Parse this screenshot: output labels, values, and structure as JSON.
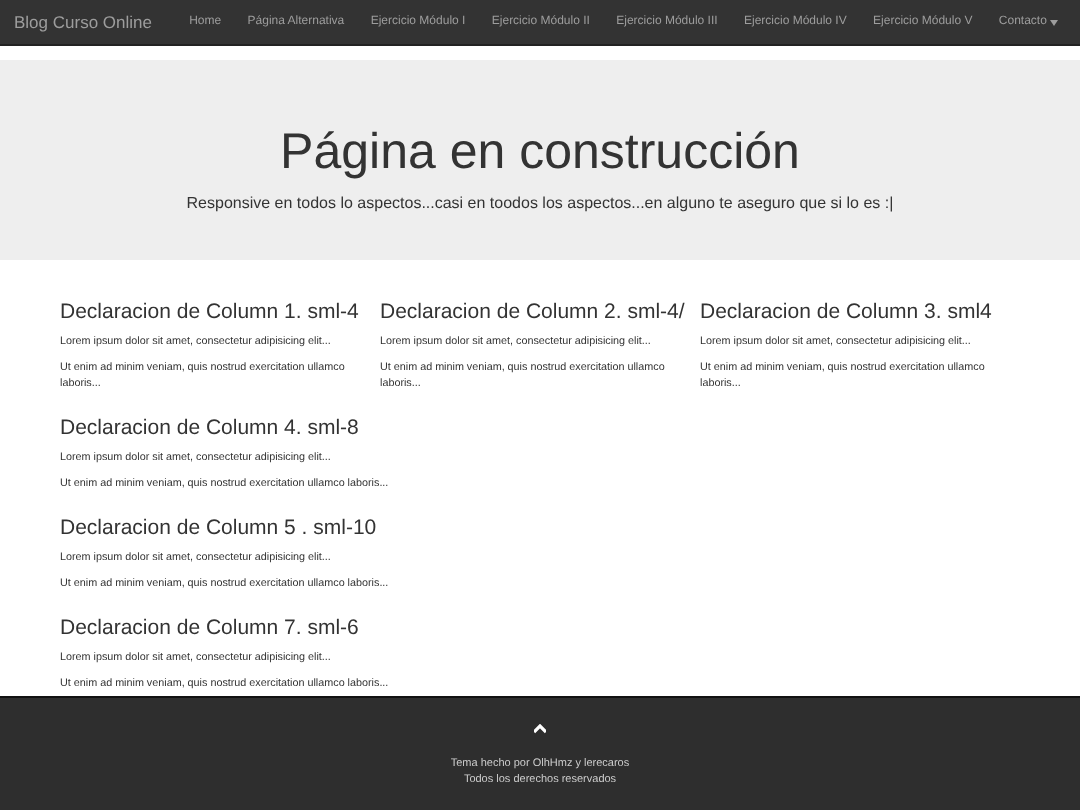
{
  "navbar": {
    "brand": "Blog Curso Online",
    "items": [
      {
        "label": "Home",
        "kind": "link"
      },
      {
        "label": "Página Alternativa",
        "kind": "link"
      },
      {
        "label": "Ejercicio Módulo I",
        "kind": "link"
      },
      {
        "label": "Ejercicio Módulo II",
        "kind": "link"
      },
      {
        "label": "Ejercicio Módulo III",
        "kind": "link"
      },
      {
        "label": "Ejercicio Módulo IV",
        "kind": "link"
      },
      {
        "label": "Ejercicio Módulo V",
        "kind": "link"
      },
      {
        "label": "Contacto",
        "kind": "dropdown"
      }
    ]
  },
  "hero": {
    "title": "Página en construcción",
    "subtitle": "Responsive en todos lo aspectos...casi en toodos los aspectos...en alguno te aseguro que si lo es :|"
  },
  "rows": [
    {
      "columns": [
        {
          "heading": "Declaracion de Column 1. sml-4",
          "paragraphs": [
            "Lorem ipsum dolor sit amet, consectetur adipisicing elit...",
            "Ut enim ad minim veniam, quis nostrud exercitation ullamco laboris..."
          ]
        },
        {
          "heading": "Declaracion de Column 2. sml-4/",
          "paragraphs": [
            "Lorem ipsum dolor sit amet, consectetur adipisicing elit...",
            "Ut enim ad minim veniam, quis nostrud exercitation ullamco laboris..."
          ]
        },
        {
          "heading": "Declaracion de Column 3. sml4",
          "paragraphs": [
            "Lorem ipsum dolor sit amet, consectetur adipisicing elit...",
            "Ut enim ad minim veniam, quis nostrud exercitation ullamco laboris..."
          ]
        }
      ]
    },
    {
      "columns": [
        {
          "heading": "Declaracion de Column 4. sml-8",
          "paragraphs": [
            "Lorem ipsum dolor sit amet, consectetur adipisicing elit...",
            "Ut enim ad minim veniam, quis nostrud exercitation ullamco laboris..."
          ]
        }
      ]
    },
    {
      "columns": [
        {
          "heading": "Declaracion de Column 5 . sml-10",
          "paragraphs": [
            "Lorem ipsum dolor sit amet, consectetur adipisicing elit...",
            "Ut enim ad minim veniam, quis nostrud exercitation ullamco laboris..."
          ]
        }
      ]
    },
    {
      "columns": [
        {
          "heading": "Declaracion de Column 7. sml-6",
          "paragraphs": [
            "Lorem ipsum dolor sit amet, consectetur adipisicing elit...",
            "Ut enim ad minim veniam, quis nostrud exercitation ullamco laboris..."
          ]
        }
      ]
    }
  ],
  "footer": {
    "lines": [
      "Tema hecho por OlhHmz y lerecaros",
      "Todos los derechos reservados"
    ]
  }
}
